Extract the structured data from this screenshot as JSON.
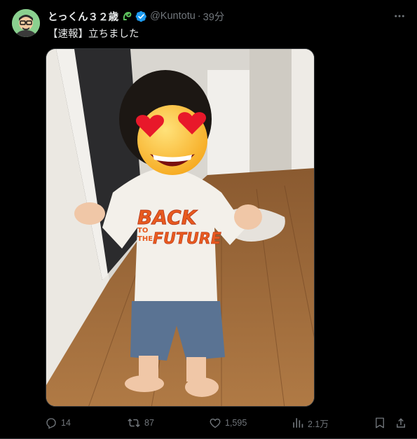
{
  "author": {
    "display_name": "とっくん３２歳",
    "handle": "@Kuntotu",
    "separator": "·",
    "time_ago": "39分",
    "verified": true,
    "badge_icon": "sprout-icon"
  },
  "tweet": {
    "text": "【速報】立ちました"
  },
  "media": {
    "shirt_text_top": "BACK",
    "shirt_text_bottom": "FUTURE",
    "shirt_text_to": "TO",
    "shirt_text_the": "THE"
  },
  "actions": {
    "replies": "14",
    "reposts": "87",
    "likes": "1,595",
    "views": "2.1万"
  },
  "colors": {
    "background": "#000000",
    "text": "#e7e9ea",
    "secondary": "#71767b",
    "verified": "#1d9bf0",
    "badge": "#5dc35d"
  }
}
